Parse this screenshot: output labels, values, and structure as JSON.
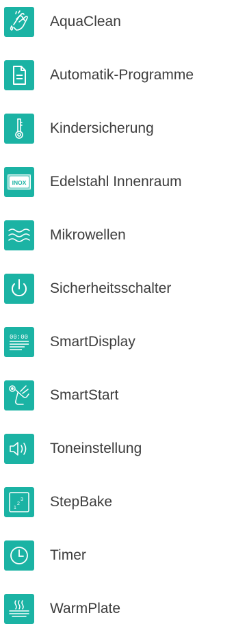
{
  "accent_color": "#1bb3a4",
  "features": [
    {
      "label": "AquaClean",
      "icon": "hand-wash-icon"
    },
    {
      "label": "Automatik-Programme",
      "icon": "document-icon"
    },
    {
      "label": "Kindersicherung",
      "icon": "key-icon"
    },
    {
      "label": "Edelstahl Innenraum",
      "icon": "inox-icon"
    },
    {
      "label": "Mikrowellen",
      "icon": "waves-icon"
    },
    {
      "label": "Sicherheitsschalter",
      "icon": "power-icon"
    },
    {
      "label": "SmartDisplay",
      "icon": "display-icon"
    },
    {
      "label": "SmartStart",
      "icon": "touch-start-icon"
    },
    {
      "label": "Toneinstellung",
      "icon": "speaker-icon"
    },
    {
      "label": "StepBake",
      "icon": "steps-icon"
    },
    {
      "label": "Timer",
      "icon": "clock-icon"
    },
    {
      "label": "WarmPlate",
      "icon": "warm-plate-icon"
    }
  ],
  "inox_text": "INOX",
  "display_text": "00:00"
}
